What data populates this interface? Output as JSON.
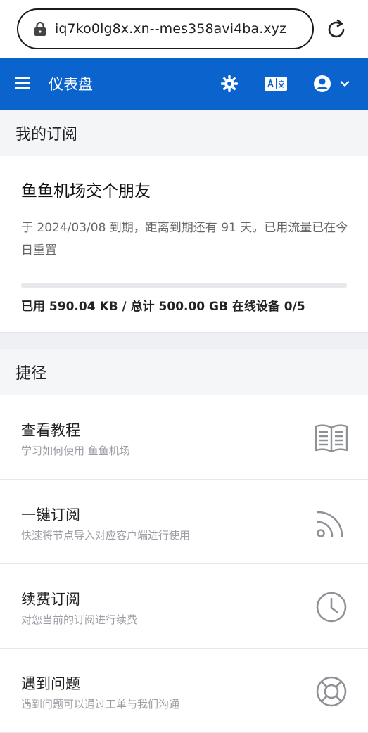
{
  "browser": {
    "url": "iq7ko0lg8x.xn--mes358avi4ba.xyz"
  },
  "header": {
    "title": "仪表盘",
    "icons": [
      "menu-icon",
      "gear-icon",
      "translate-icon",
      "account-icon",
      "chevron-down-icon"
    ],
    "color": "#0b63ce"
  },
  "subscription": {
    "section_title": "我的订阅",
    "plan_name": "鱼鱼机场交个朋友",
    "description": "于 2024/03/08 到期，距离到期还有 91 天。已用流量已在今日重置",
    "usage_text": "已用 590.04 KB / 总计 500.00 GB 在线设备 0/5",
    "used_fraction": 0.0
  },
  "shortcuts": {
    "section_title": "捷径",
    "items": [
      {
        "title": "查看教程",
        "subtitle": "学习如何使用 鱼鱼机场",
        "icon": "book-icon"
      },
      {
        "title": "一键订阅",
        "subtitle": "快速将节点导入对应客户端进行使用",
        "icon": "rss-icon"
      },
      {
        "title": "续费订阅",
        "subtitle": "对您当前的订阅进行续费",
        "icon": "clock-icon"
      },
      {
        "title": "遇到问题",
        "subtitle": "遇到问题可以通过工单与我们沟通",
        "icon": "lifebuoy-icon"
      }
    ]
  }
}
